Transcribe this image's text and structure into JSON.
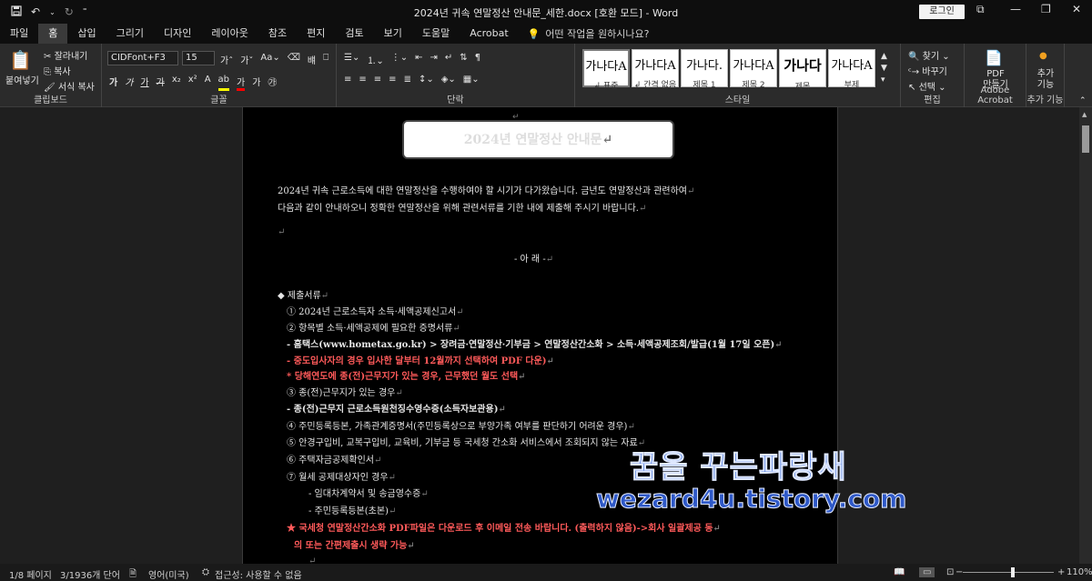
{
  "window": {
    "title": "2024년 귀속 연말정산 안내문_세한.docx [호환 모드]  -  Word",
    "login_label": "로그인"
  },
  "tabs": [
    "파일",
    "홈",
    "삽입",
    "그리기",
    "디자인",
    "레이아웃",
    "참조",
    "편지",
    "검토",
    "보기",
    "도움말",
    "Acrobat"
  ],
  "tell_me_placeholder": "어떤 작업을 원하시나요?",
  "ribbon": {
    "clipboard": {
      "paste": "붙여넣기",
      "cut": "잘라내기",
      "copy": "복사",
      "format_painter": "서식 복사",
      "label": "클립보드"
    },
    "font": {
      "name": "CIDFont+F3",
      "size": "15",
      "label": "글꼴"
    },
    "paragraph": {
      "label": "단락"
    },
    "styles": {
      "label": "스타일",
      "items": [
        {
          "sample": "가나다A",
          "name": "↲ 표준"
        },
        {
          "sample": "가나다A",
          "name": "↲ 간격 없음"
        },
        {
          "sample": "가나다.",
          "name": "제목 1"
        },
        {
          "sample": "가나다A",
          "name": "제목 2"
        },
        {
          "sample": "가나다",
          "name": "제목"
        },
        {
          "sample": "가나다A",
          "name": "부제"
        }
      ]
    },
    "editing": {
      "find": "찾기",
      "replace": "바꾸기",
      "select": "선택",
      "label": "편집"
    },
    "acrobat": {
      "create_pdf": "PDF\n만들기",
      "label": "Adobe Acrobat"
    },
    "addins": {
      "add": "추가\n기능",
      "label": "추가 기능"
    }
  },
  "document": {
    "title": "2024년 연말정산 안내문",
    "intro1": "2024년 귀속 근로소득에 대한 연말정산을 수행하여야 할 시기가 다가왔습니다. 금년도 연말정산과 관련하여",
    "intro2": "다음과 같이 안내하오니 정확한 연말정산을 위해 관련서류를 기한 내에 제출해 주시기 바랍니다.",
    "heading": "- 아  래 -",
    "section": "◆ 제출서류",
    "items": [
      "① 2024년 근로소득자 소득·세액공제신고서",
      "② 항목별 소득·세액공제에 필요한 증명서류",
      "- 홈택스(www.hometax.go.kr) > 장려금·연말정산·기부금 > 연말정산간소화 > 소득·세액공제조회/발급(1월 17일 오픈)",
      "- 중도입사자의 경우 입사한 달부터 12월까지 선택하여 PDF 다운)",
      "* 당해연도에 종(전)근무지가 있는 경우, 근무했던 월도 선택",
      "③ 종(전)근무지가 있는 경우",
      "- 종(전)근무지 근로소득원천징수영수증(소득자보관용)",
      "④ 주민등록등본, 가족관계증명서(주민등록상으로 부양가족 여부를 판단하기 어려운 경우)",
      "⑤ 안경구입비, 교복구입비, 교육비, 기부금 등 국세청 간소화 서비스에서 조회되지 않는 자료",
      "⑥ 주택자금공제확인서",
      "⑦ 월세 공제대상자인 경우",
      "- 임대차계약서 및 송금영수증",
      "- 주민등록등본(초본)",
      "★  국세청 연말정산간소화 PDF파일은 다운로드 후 이메일 전송 바랍니다. (출력하지 않음)->회사 일괄제공 동",
      "의 또는 간편제출시 생략 가능"
    ]
  },
  "watermark": {
    "line1": "꿈을 꾸는파랑새",
    "line2": "wezard4u.tistory.com"
  },
  "status": {
    "page": "1/8 페이지",
    "words": "3/1936개 단어",
    "language": "영어(미국)",
    "accessibility": "접근성: 사용할 수 없음",
    "zoom": "110%",
    "zoom_minus": "−",
    "zoom_plus": "+"
  }
}
